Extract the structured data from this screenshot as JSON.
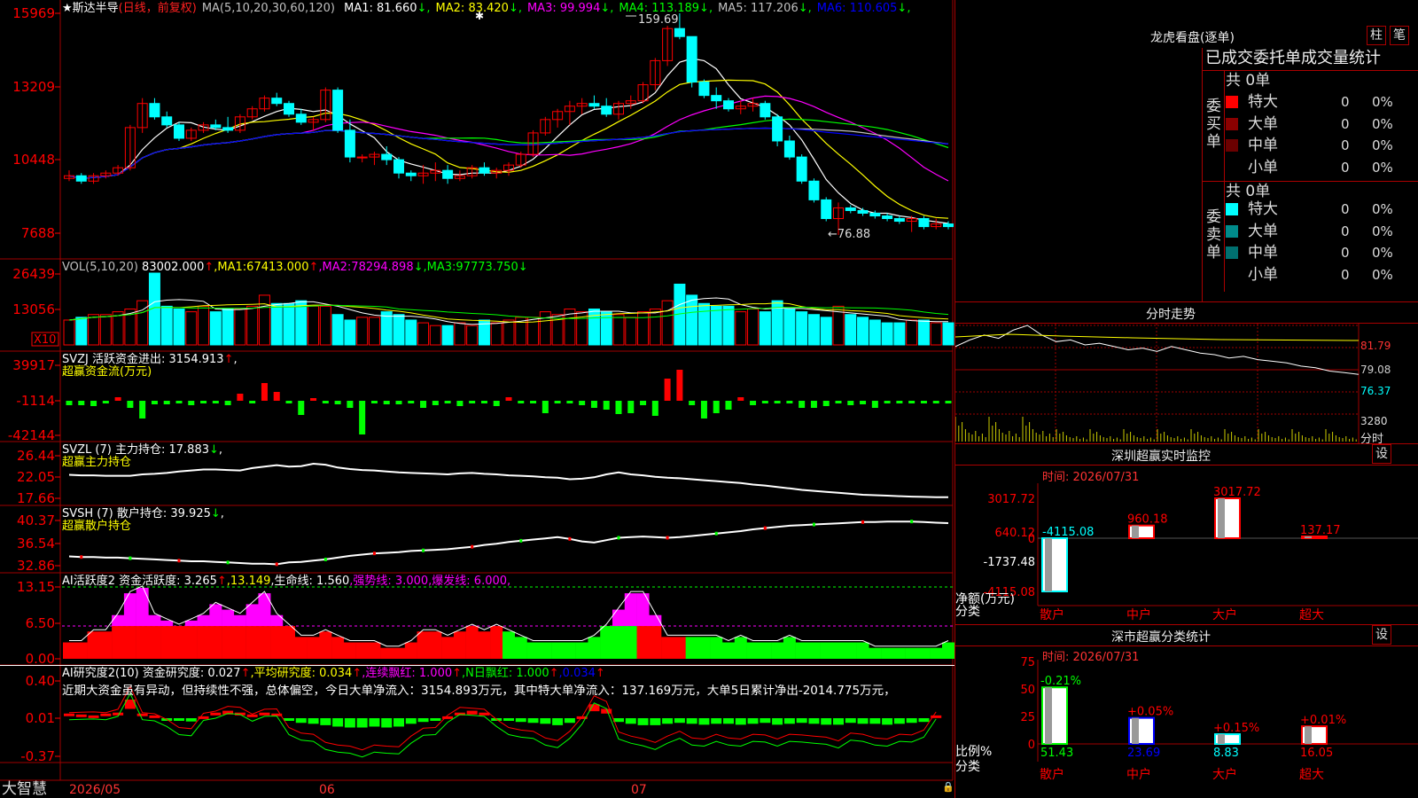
{
  "stock": {
    "name": "★斯达半导",
    "mode": "(日线，前复权)",
    "ma_header": "MA(5,10,20,30,60,120)",
    "ma": [
      {
        "label": "MA1:",
        "value": "81.660",
        "arrow": "↓",
        "color": "#ffffff"
      },
      {
        "label": "MA2:",
        "value": "83.420",
        "arrow": "↓",
        "color": "#ffff00"
      },
      {
        "label": "MA3:",
        "value": "99.994",
        "arrow": "↓",
        "color": "#ff00ff"
      },
      {
        "label": "MA4:",
        "value": "113.189",
        "arrow": "↓",
        "color": "#00ff00"
      },
      {
        "label": "MA5:",
        "value": "117.206",
        "arrow": "↓",
        "color": "#c0c0c0"
      },
      {
        "label": "MA6:",
        "value": "110.605",
        "arrow": "↓",
        "color": "#0000ff"
      }
    ],
    "price_axis": [
      "15969",
      "13209",
      "10448",
      "7688"
    ],
    "high_label": "159.69",
    "low_label": "←76.88"
  },
  "vol": {
    "header": "VOL(5,10,20)",
    "value": "83002.000",
    "up": "↑",
    "ma1_label": "MA1:",
    "ma1": "67413.000",
    "ma1_arrow": "↑",
    "ma2_label": "MA2:",
    "ma2": "78294.898",
    "ma2_arrow": "↓",
    "ma3_label": "MA3:",
    "ma3": "97773.750",
    "ma3_arrow": "↓",
    "axis": [
      "26439",
      "13056"
    ],
    "unit": "X10"
  },
  "svzj": {
    "header": "SVZJ  活跃资金进出: ",
    "value": "3154.913",
    "arrow": "↑",
    "suffix": ",",
    "sub": "超赢资金流(万元)",
    "axis": [
      "39917",
      "-1114",
      "-42144"
    ]
  },
  "svzl": {
    "header": "SVZL (7) 主力持仓: ",
    "value": "17.883",
    "arrow": "↓",
    "suffix": ",",
    "sub": "超赢主力持仓",
    "axis": [
      "26.44",
      "22.05",
      "17.66"
    ]
  },
  "svsh": {
    "header": "SVSH (7) 散户持仓: ",
    "value": "39.925",
    "arrow": "↓",
    "suffix": ",",
    "sub": "超赢散户持仓",
    "axis": [
      "40.37",
      "36.54",
      "32.86"
    ]
  },
  "ai1": {
    "header": "AI活跃度2 资金活跃度: ",
    "value": "3.265",
    "arrow": "↑",
    "v2": ",13.149",
    "life": ",生命线: 1.560",
    "strong": ",强势线: 3.000",
    "burst": ",爆发线: 6.000,",
    "axis": [
      "13.15",
      "6.50",
      "0.00"
    ]
  },
  "ai2": {
    "header": "AI研究度2(10) 资金研究度: ",
    "value": "0.027",
    "arrow": "↑",
    "avg": ",平均研究度: 0.034",
    "avg_arrow": "↑",
    "red": ",连续飘红: 1.000",
    "red_arrow": "↑",
    "nred": ",N日飘红: 1.000",
    "nred_arrow": "↑",
    "last": ",0.034",
    "last_arrow": "↑",
    "comment": "近期大资金虽有异动，但持续性不强，总体偏空，今日大单净流入：3154.893万元，其中特大单净流入：137.169万元，大单5日累计净出-2014.775万元，",
    "axis": [
      "0.40",
      "0.01",
      "-0.37"
    ]
  },
  "footer": {
    "brand": "大智慧",
    "dates": [
      "2026/05",
      "06",
      "07"
    ]
  },
  "right": {
    "lhb_title": "龙虎看盘(逐单)",
    "tab1": "柱",
    "tab2": "笔",
    "stats_title": "已成交委托单成交量统计",
    "buy_label": "委买单",
    "sell_label": "委卖单",
    "buy_total": "共 0单",
    "sell_total": "共 0单",
    "buy_rows": [
      {
        "name": "特大",
        "n": "0",
        "pct": "0%",
        "color": "#ff0000"
      },
      {
        "name": "大单",
        "n": "0",
        "pct": "0%",
        "color": "#8b0000"
      },
      {
        "name": "中单",
        "n": "0",
        "pct": "0%",
        "color": "#6b0000"
      },
      {
        "name": "小单",
        "n": "0",
        "pct": "0%",
        "color": ""
      }
    ],
    "sell_rows": [
      {
        "name": "特大",
        "n": "0",
        "pct": "0%",
        "color": "#00ffff"
      },
      {
        "name": "大单",
        "n": "0",
        "pct": "0%",
        "color": "#008b8b"
      },
      {
        "name": "中单",
        "n": "0",
        "pct": "0%",
        "color": "#007070"
      },
      {
        "name": "小单",
        "n": "0",
        "pct": "0%",
        "color": ""
      }
    ],
    "intraday_title": "分时走势",
    "intraday_axis": [
      "81.79",
      "79.08",
      "76.37"
    ],
    "intraday_vol": "3280",
    "intraday_vol_unit": "分时",
    "monitor_title": "深圳超赢实时监控",
    "monitor_settings": "设",
    "monitor_time": "时间: 2026/07/31",
    "monitor_axis": [
      "3017.72",
      "640.12",
      "0",
      "-1737.48",
      "-4115.08"
    ],
    "monitor_ylabel": "净额(万元)",
    "monitor_xlabel": "分类",
    "class_title": "深市超赢分类统计",
    "class_settings": "设",
    "class_time": "时间: 2026/07/31",
    "class_axis": [
      "75",
      "50",
      "25",
      "0"
    ],
    "class_ylabel": "比例%",
    "class_xlabel": "分类"
  },
  "colors": {
    "up": "#ff0000",
    "down": "#00ffff",
    "ma1": "#ffffff",
    "ma2": "#ffff00",
    "ma3": "#ff00ff",
    "ma4": "#00ff00",
    "ma5": "#c0c0c0",
    "ma6": "#0000ff",
    "grid": "#a00000"
  },
  "chart_data": [
    {
      "type": "candlestick",
      "title": "斯达半导",
      "ylim": [
        76.88,
        159.69
      ],
      "annotations": [
        "159.69",
        "←76.88"
      ],
      "ohlc": [
        [
          98,
          101,
          97,
          99
        ],
        [
          99,
          100,
          96,
          97
        ],
        [
          97,
          100,
          96,
          99
        ],
        [
          99,
          101,
          98,
          100
        ],
        [
          100,
          103,
          99,
          102
        ],
        [
          102,
          118,
          101,
          117
        ],
        [
          117,
          128,
          115,
          126
        ],
        [
          126,
          128,
          120,
          121
        ],
        [
          121,
          123,
          117,
          118
        ],
        [
          118,
          119,
          112,
          113
        ],
        [
          113,
          117,
          112,
          116
        ],
        [
          116,
          119,
          115,
          118
        ],
        [
          118,
          120,
          116,
          117
        ],
        [
          117,
          121,
          115,
          116
        ],
        [
          116,
          122,
          115,
          121
        ],
        [
          121,
          125,
          120,
          124
        ],
        [
          124,
          129,
          123,
          128
        ],
        [
          128,
          130,
          125,
          126
        ],
        [
          126,
          127,
          121,
          122
        ],
        [
          122,
          124,
          118,
          119
        ],
        [
          119,
          121,
          116,
          120
        ],
        [
          120,
          132,
          119,
          131
        ],
        [
          131,
          132,
          115,
          116
        ],
        [
          116,
          120,
          104,
          106
        ],
        [
          106,
          107,
          104,
          106
        ],
        [
          106,
          108,
          103,
          107
        ],
        [
          107,
          110,
          103,
          105
        ],
        [
          105,
          106,
          98,
          100
        ],
        [
          100,
          101,
          97,
          99
        ],
        [
          99,
          103,
          96,
          100
        ],
        [
          100,
          104,
          97,
          101
        ],
        [
          101,
          103,
          96,
          98
        ],
        [
          98,
          101,
          97,
          99
        ],
        [
          99,
          103,
          98,
          102
        ],
        [
          102,
          104,
          99,
          100
        ],
        [
          100,
          102,
          98,
          101
        ],
        [
          101,
          104,
          99,
          103
        ],
        [
          103,
          108,
          102,
          107
        ],
        [
          107,
          116,
          106,
          115
        ],
        [
          115,
          121,
          114,
          120
        ],
        [
          120,
          124,
          117,
          123
        ],
        [
          123,
          127,
          118,
          125
        ],
        [
          125,
          128,
          122,
          126
        ],
        [
          126,
          129,
          124,
          125
        ],
        [
          125,
          128,
          121,
          122
        ],
        [
          122,
          127,
          120,
          126
        ],
        [
          126,
          129,
          124,
          127
        ],
        [
          127,
          134,
          126,
          133
        ],
        [
          133,
          143,
          131,
          142
        ],
        [
          142,
          155,
          140,
          154
        ],
        [
          154,
          159.69,
          150,
          151
        ],
        [
          151,
          139,
          132,
          134
        ],
        [
          134,
          135,
          128,
          129
        ],
        [
          129,
          132,
          124,
          127
        ],
        [
          127,
          128,
          123,
          124
        ],
        [
          124,
          127,
          122,
          125
        ],
        [
          125,
          128,
          123,
          126
        ],
        [
          126,
          127,
          120,
          121
        ],
        [
          121,
          122,
          110,
          112
        ],
        [
          112,
          114,
          105,
          106
        ],
        [
          106,
          107,
          96,
          97
        ],
        [
          97,
          98,
          89,
          90
        ],
        [
          90,
          91,
          82,
          83
        ],
        [
          83,
          89,
          76.88,
          87
        ],
        [
          87,
          88,
          85,
          86
        ],
        [
          86,
          87,
          84,
          85
        ],
        [
          85,
          86,
          83,
          84
        ],
        [
          84,
          85,
          82,
          83
        ],
        [
          83,
          84,
          81,
          82
        ],
        [
          82,
          84,
          78,
          83
        ],
        [
          83,
          84,
          79,
          80
        ],
        [
          80,
          83,
          79,
          81
        ],
        [
          81,
          82,
          79,
          80
        ]
      ]
    },
    {
      "type": "bar",
      "title": "VOL(5,10,20)",
      "values": [
        9,
        10,
        11,
        11,
        12,
        13,
        16,
        26,
        14,
        13,
        12,
        14,
        12,
        13,
        13,
        14,
        18,
        15,
        15,
        16,
        14,
        14,
        11,
        9,
        10,
        10,
        12,
        11,
        9,
        8,
        7,
        7,
        8,
        7,
        9,
        8,
        9,
        10,
        10,
        12,
        11,
        13,
        12,
        13,
        12,
        11,
        10,
        12,
        13,
        16,
        22,
        18,
        15,
        14,
        14,
        12,
        13,
        12,
        16,
        13,
        12,
        11,
        10,
        14,
        11,
        10,
        9,
        8,
        8,
        9,
        9,
        8,
        8
      ]
    },
    {
      "type": "bar",
      "title": "SVZJ 活跃资金进出",
      "values": [
        -5,
        -5,
        -6,
        -3,
        4,
        -8,
        -20,
        -4,
        -4,
        -3,
        -5,
        -3,
        -3,
        -5,
        8,
        -3,
        20,
        10,
        -3,
        -16,
        3,
        -3,
        -4,
        -8,
        -38,
        -3,
        -4,
        -4,
        -3,
        -8,
        -5,
        -3,
        -6,
        -3,
        -3,
        -6,
        4,
        -3,
        -3,
        -14,
        -3,
        -3,
        -5,
        -8,
        -10,
        -15,
        -14,
        -5,
        -17,
        25,
        35,
        -5,
        -20,
        -14,
        -10,
        4,
        -5,
        -3,
        -3,
        -3,
        -8,
        -8,
        -6,
        -3,
        -5,
        -4,
        -8,
        -3,
        -3,
        -3,
        -3,
        -3,
        -3,
        -3
      ],
      "ylim": [
        -42144,
        39917
      ]
    },
    {
      "type": "line",
      "title": "SVZL 主力持仓",
      "series": [
        {
          "name": "主力持仓",
          "values": [
            22.5,
            22.4,
            22.4,
            22.3,
            22.3,
            22.3,
            22.6,
            22.7,
            22.9,
            23.2,
            23.4,
            23.6,
            23.6,
            23.5,
            23.4,
            23.9,
            24.2,
            24.5,
            24.2,
            24.3,
            24.8,
            24.6,
            24.0,
            23.7,
            23.5,
            23.4,
            23.2,
            23.0,
            22.9,
            22.8,
            22.7,
            22.6,
            22.8,
            22.9,
            22.7,
            22.6,
            22.4,
            22.3,
            22.2,
            22.0,
            21.9,
            21.6,
            21.7,
            22.0,
            22.6,
            23.0,
            22.6,
            22.4,
            22.1,
            21.9,
            21.8,
            21.6,
            21.4,
            21.2,
            21.0,
            20.8,
            20.5,
            20.3,
            20.0,
            19.7,
            19.4,
            19.2,
            19.0,
            18.8,
            18.6,
            18.4,
            18.3,
            18.2,
            18.1,
            18.0,
            17.95,
            17.9,
            17.88
          ]
        }
      ],
      "ylim": [
        17.66,
        26.44
      ]
    },
    {
      "type": "line",
      "title": "SVSH 散户持仓",
      "series": [
        {
          "name": "散户持仓",
          "values": [
            34.4,
            34.3,
            34.3,
            34.2,
            34.2,
            34.1,
            34.0,
            33.9,
            33.8,
            33.7,
            33.6,
            33.6,
            33.5,
            33.4,
            33.3,
            33.2,
            33.2,
            33.1,
            33.4,
            33.5,
            33.7,
            33.9,
            34.2,
            34.5,
            34.7,
            34.9,
            35.0,
            35.1,
            35.3,
            35.4,
            35.5,
            35.6,
            35.8,
            36.0,
            36.3,
            36.5,
            36.8,
            37.0,
            37.2,
            37.4,
            37.6,
            37.3,
            36.9,
            36.7,
            37.1,
            37.5,
            37.6,
            37.7,
            37.6,
            37.5,
            37.6,
            37.8,
            38.0,
            38.2,
            38.4,
            38.6,
            38.9,
            39.1,
            39.3,
            39.5,
            39.6,
            39.7,
            39.8,
            39.9,
            40.0,
            40.1,
            40.1,
            40.2,
            40.2,
            40.2,
            40.1,
            40.0,
            39.93
          ]
        }
      ],
      "ylim": [
        32.86,
        40.37
      ]
    },
    {
      "type": "bar",
      "title": "AI活跃度2 资金活跃度",
      "values": [
        3,
        3,
        5,
        5,
        8,
        12,
        13,
        8,
        7,
        6,
        7,
        8,
        10,
        9,
        8,
        10,
        12,
        8,
        6,
        4,
        4,
        5,
        4,
        3,
        3,
        3,
        2,
        2,
        3,
        5,
        5,
        4,
        5,
        6,
        5,
        6,
        5,
        4,
        3,
        3,
        3,
        3,
        3,
        4,
        6,
        9,
        12,
        12,
        8,
        4,
        4,
        4,
        4,
        4,
        3,
        4,
        3,
        3,
        3,
        4,
        3,
        3,
        3,
        3,
        3,
        3,
        2,
        2,
        2,
        2,
        2,
        2,
        3
      ],
      "ylim": [
        0,
        13.15
      ]
    },
    {
      "type": "bar",
      "title": "AI研究度2(10) 资金研究度",
      "values": [
        0.05,
        0.04,
        0.03,
        0.05,
        0.06,
        0.2,
        0.05,
        0.03,
        -0.02,
        -0.05,
        -0.07,
        0.02,
        0.06,
        0.08,
        0.06,
        0.04,
        0.06,
        0.05,
        -0.05,
        -0.1,
        -0.12,
        -0.15,
        -0.18,
        -0.2,
        -0.2,
        -0.18,
        -0.2,
        -0.18,
        -0.12,
        -0.08,
        -0.05,
        0.02,
        0.06,
        0.08,
        0.06,
        -0.02,
        -0.05,
        -0.08,
        -0.1,
        -0.12,
        -0.15,
        -0.1,
        0.02,
        0.15,
        0.1,
        -0.08,
        -0.12,
        -0.15,
        -0.15,
        -0.12,
        -0.1,
        -0.12,
        -0.14,
        -0.12,
        -0.12,
        -0.14,
        -0.12,
        -0.1,
        -0.14,
        -0.12,
        -0.1,
        -0.12,
        -0.14,
        -0.14,
        -0.1,
        -0.12,
        -0.12,
        -0.14,
        -0.12,
        -0.1,
        -0.08,
        0.03
      ],
      "ylim": [
        -0.37,
        0.4
      ]
    },
    {
      "type": "bar",
      "title": "深圳超赢实时监控",
      "categories": [
        "散户",
        "中户",
        "大户",
        "超大"
      ],
      "values": [
        -4115.08,
        960.18,
        3017.72,
        137.17
      ],
      "ylim": [
        -4115.08,
        3017.72
      ]
    },
    {
      "type": "bar",
      "title": "深市超赢分类统计",
      "categories": [
        "散户",
        "中户",
        "大户",
        "超大"
      ],
      "values": [
        51.43,
        23.69,
        8.83,
        16.05
      ],
      "changes": [
        "-0.21%",
        "+0.05%",
        "+0.15%",
        "+0.01%"
      ],
      "ylim": [
        0,
        75
      ]
    },
    {
      "type": "line",
      "title": "分时走势",
      "series": [
        {
          "name": "价格",
          "values": [
            80.5,
            80.9,
            81.2,
            81.0,
            81.5,
            81.79,
            81.2,
            80.8,
            80.9,
            80.6,
            80.7,
            80.5,
            80.3,
            80.4,
            80.2,
            80.5,
            80.3,
            80.1,
            80.0,
            79.8,
            79.9,
            79.7,
            79.6,
            79.5,
            79.3,
            79.2,
            79.0,
            78.9,
            78.8
          ]
        }
      ],
      "ylim": [
        76.37,
        81.79
      ]
    }
  ]
}
